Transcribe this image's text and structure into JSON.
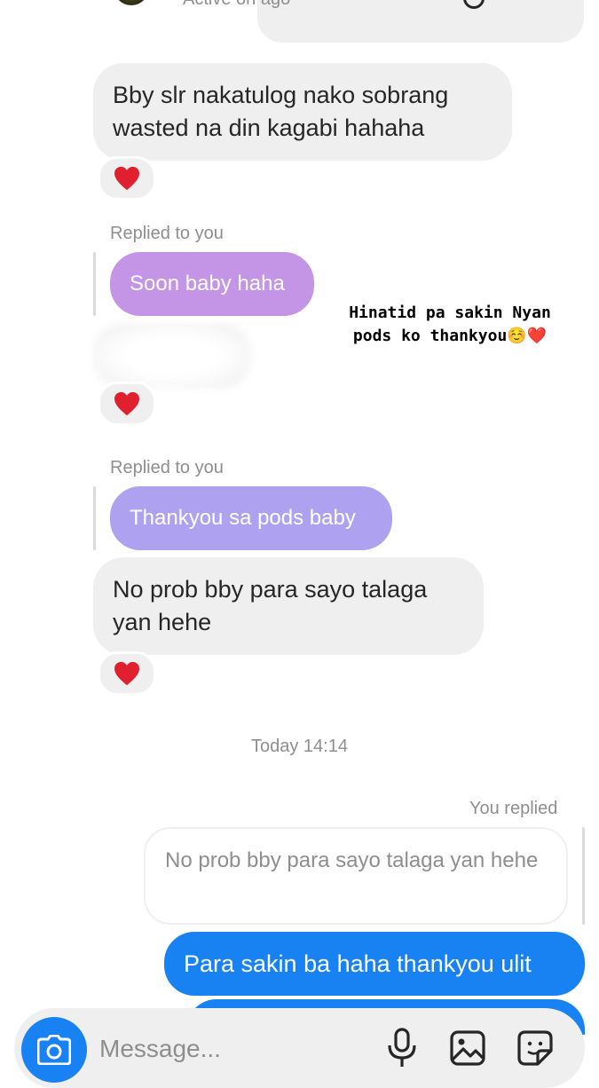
{
  "header": {
    "status": "Active on ago"
  },
  "messages": {
    "m1": "Bby slr nakatulog nako sobrang wasted na din kagabi hahaha",
    "replied_label_1": "Replied to you",
    "reply1": "Soon baby haha",
    "replied_label_2": "Replied to you",
    "reply2": "Thankyou sa pods baby",
    "m2": "No prob bby para sayo talaga yan hehe",
    "timestamp": "Today 14:14",
    "you_replied_label": "You replied",
    "quoted": "No prob bby para sayo talaga yan hehe",
    "sent1": "Para sakin ba haha thankyou ulit"
  },
  "sticker": {
    "line1": "Hinatid pa sakin Nyan",
    "line2": "pods ko thankyou☺️❤️"
  },
  "composer": {
    "placeholder": "Message..."
  },
  "colors": {
    "incoming_bubble": "#efefef",
    "outgoing_bubble": "#1982f3",
    "reply_purple_1": "#c495e6",
    "reply_purple_2": "#aea1ef",
    "heart": "#e0202e"
  }
}
